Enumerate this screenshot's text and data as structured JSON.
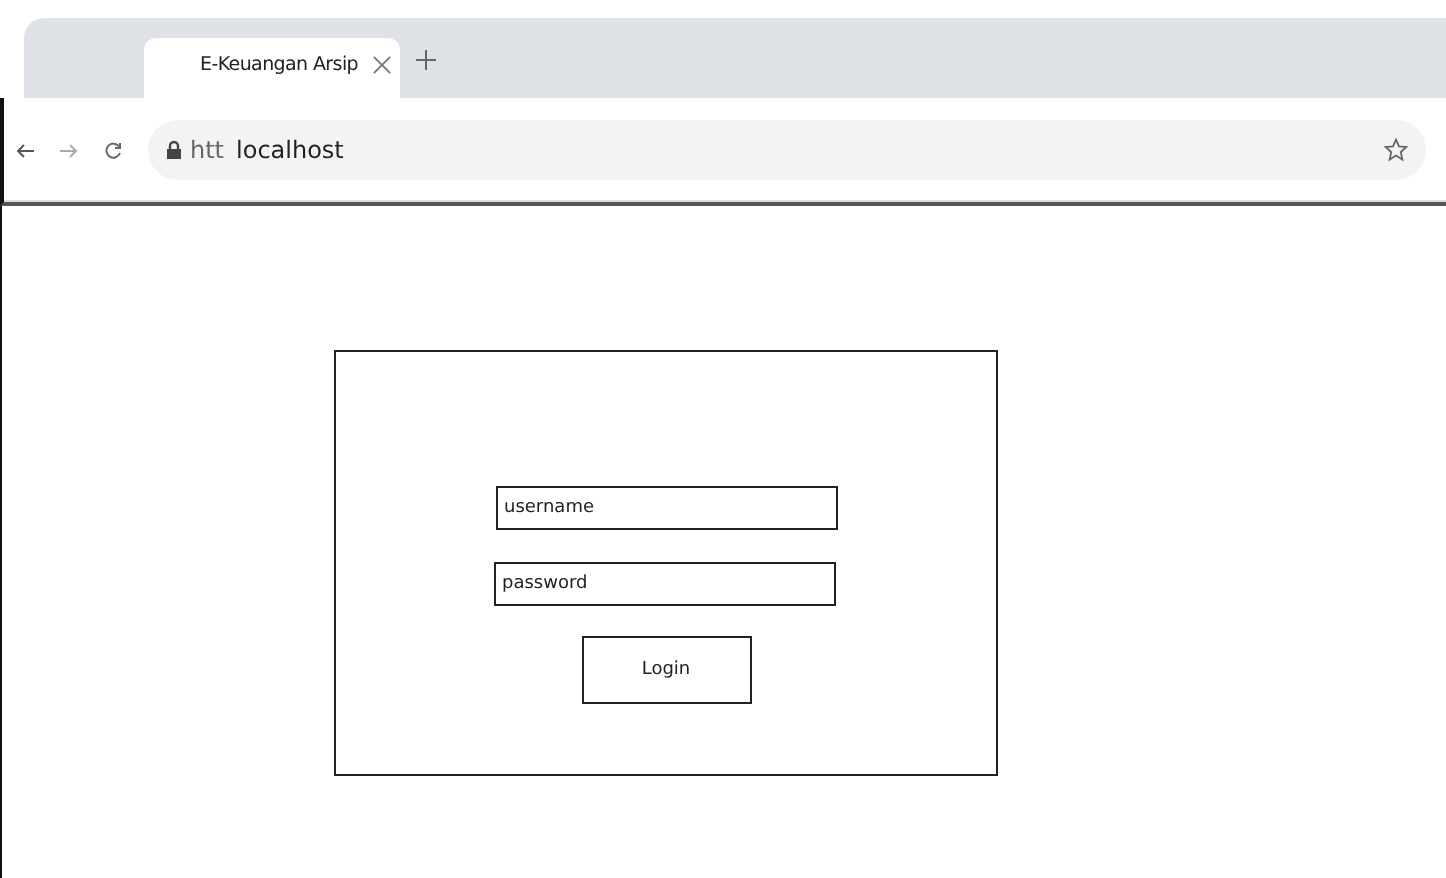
{
  "tabs": [
    {
      "label": "E-Keuangan Arsip",
      "selected": true
    }
  ],
  "address_bar": {
    "scheme": "htt",
    "url": "localhost"
  },
  "login_form": {
    "username": {
      "placeholder": "username"
    },
    "password": {
      "placeholder": "password"
    },
    "button": "Login"
  }
}
